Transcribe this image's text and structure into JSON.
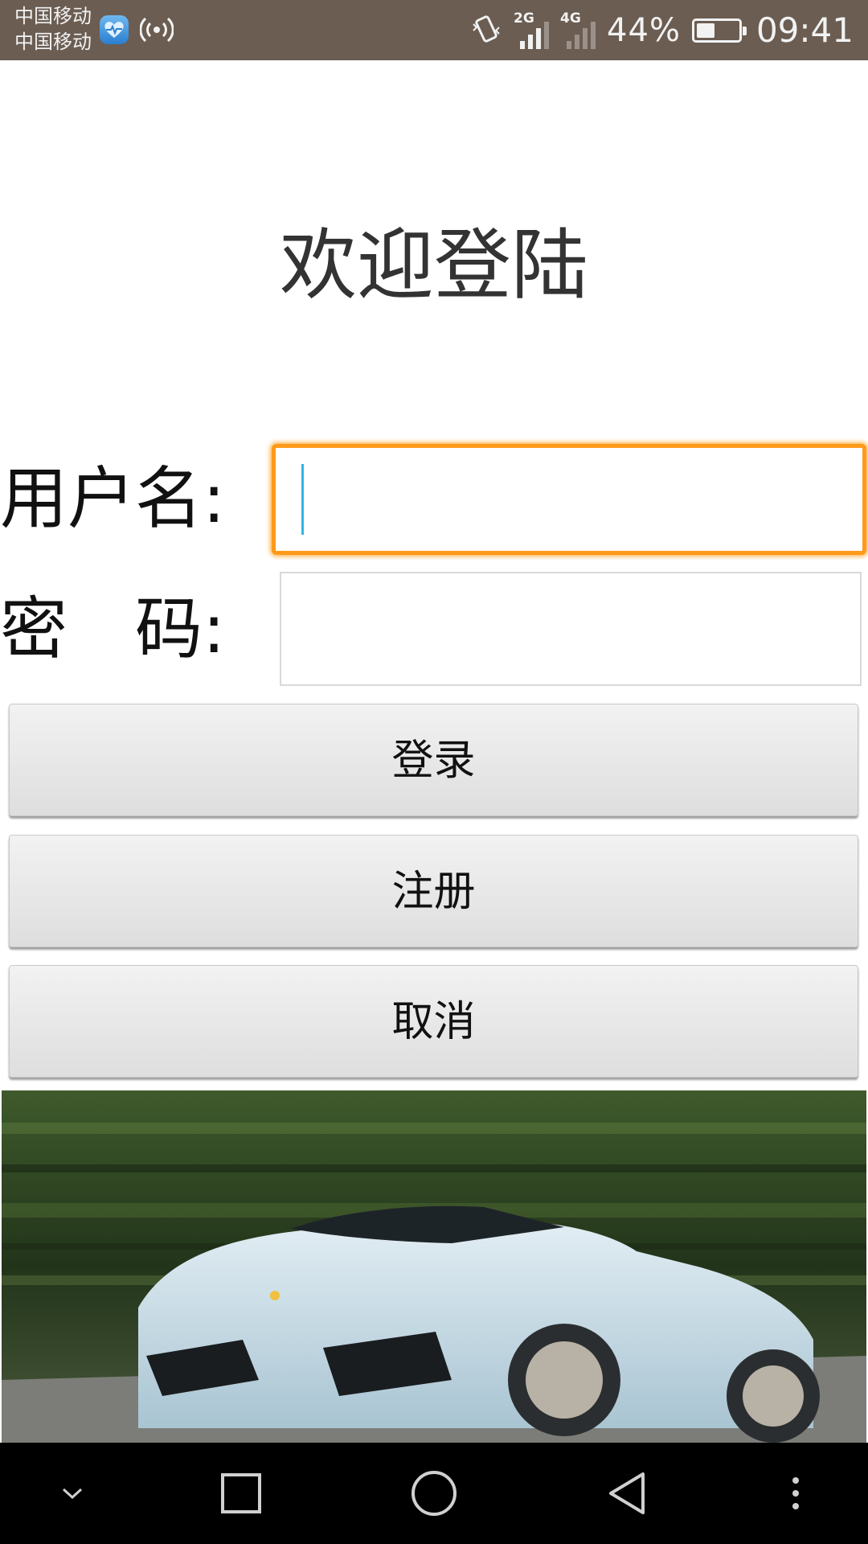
{
  "status_bar": {
    "carrier_1": "中国移动",
    "carrier_2": "中国移动",
    "signal_1_tag": "2G",
    "signal_2_tag": "4G",
    "battery_percent": "44%",
    "battery_level": 0.44,
    "time": "09:41",
    "icons": [
      "health-app-icon",
      "hotspot-icon",
      "vibrate-icon",
      "signal-icon",
      "battery-icon"
    ]
  },
  "page": {
    "title": "欢迎登陆"
  },
  "form": {
    "username_label": "用户名:",
    "username_value": "",
    "password_label": "密　码:",
    "password_value": ""
  },
  "buttons": {
    "login": "登录",
    "register": "注册",
    "cancel": "取消"
  },
  "colors": {
    "focus_border": "#ff9a1a",
    "caret": "#33b5e5",
    "status_bar_bg": "#6b5d52"
  },
  "nav_bar": {
    "icons": [
      "chevron-down-icon",
      "recents-icon",
      "home-icon",
      "back-icon",
      "more-icon"
    ]
  }
}
